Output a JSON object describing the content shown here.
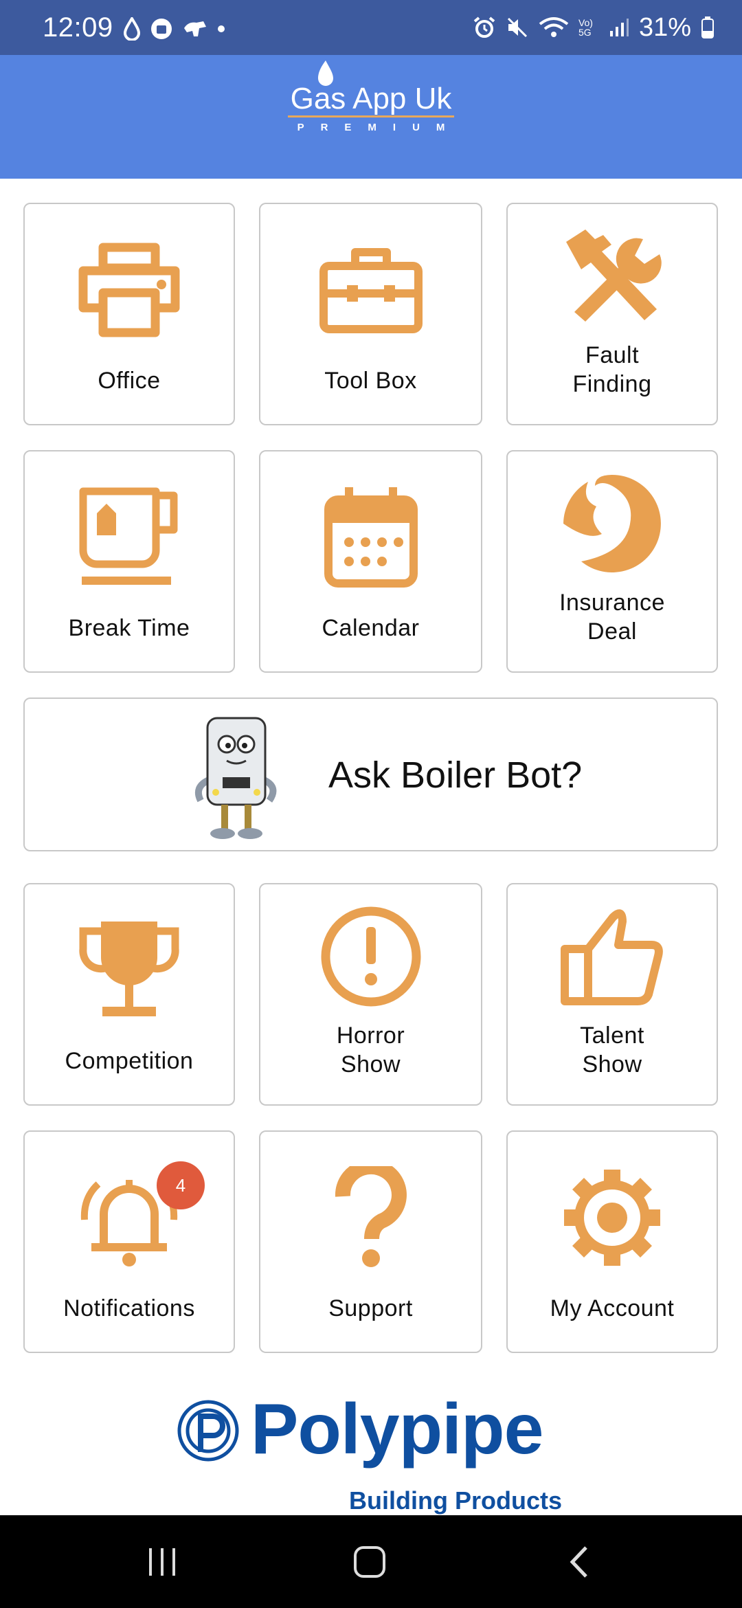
{
  "status_bar": {
    "time": "12:09",
    "battery": "31%",
    "left_icons": [
      "water-drop-icon",
      "bag-icon",
      "dog-icon",
      "dot-icon"
    ],
    "right_icons": [
      "alarm-icon",
      "mute-icon",
      "wifi-icon",
      "volte-5g-icon",
      "signal-icon",
      "battery-icon"
    ],
    "network_label": "Vo) 5G"
  },
  "header": {
    "app_title": "Gas App Uk",
    "app_subtitle": "PREMIUM",
    "background_color": "#5583e0"
  },
  "tiles": {
    "office": "Office",
    "toolbox": "Tool Box",
    "fault_finding_1": "Fault",
    "fault_finding_2": "Finding",
    "break_time": "Break Time",
    "calendar": "Calendar",
    "insurance_1": "Insurance",
    "insurance_2": "Deal",
    "competition": "Competition",
    "horror_1": "Horror",
    "horror_2": "Show",
    "talent_1": "Talent",
    "talent_2": "Show",
    "notifications": "Notifications",
    "support": "Support",
    "my_account": "My Account"
  },
  "boiler_bot": {
    "label": "Ask Boiler Bot?"
  },
  "notifications_badge": "4",
  "sponsor": {
    "name": "Polypipe",
    "subtitle": "Building Products"
  },
  "colors": {
    "icon": "#e8a050",
    "accent_text": "#0f4fa0",
    "status_bar": "#3d5a9e"
  },
  "nav": [
    "recent-apps-icon",
    "home-icon",
    "back-icon"
  ]
}
